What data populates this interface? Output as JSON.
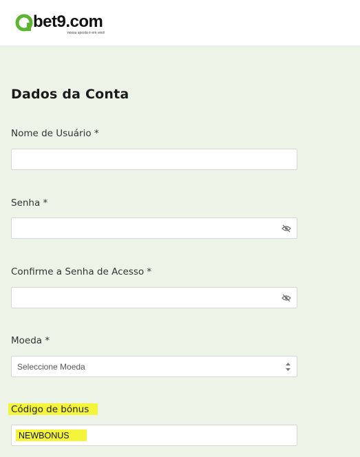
{
  "brand": {
    "name": "bet9.com",
    "tagline": "nossa aposta é em você"
  },
  "form": {
    "title": "Dados da Conta",
    "username_label": "Nome de Usuário *",
    "username_value": "",
    "password_label": "Senha *",
    "password_value": "",
    "confirm_label": "Confirme a Senha de Acesso *",
    "confirm_value": "",
    "currency_label": "Moeda *",
    "currency_selected": "Seleccione Moeda",
    "bonus_label": "Código de bónus",
    "bonus_value": "NEWBONUS"
  },
  "icons": {
    "password_toggle": "eye-slash-icon",
    "select_arrows": "updown-arrows-icon"
  },
  "colors": {
    "brand_green": "#5bb531",
    "page_background": "#eef3e8",
    "highlight": "#f4f53a"
  }
}
